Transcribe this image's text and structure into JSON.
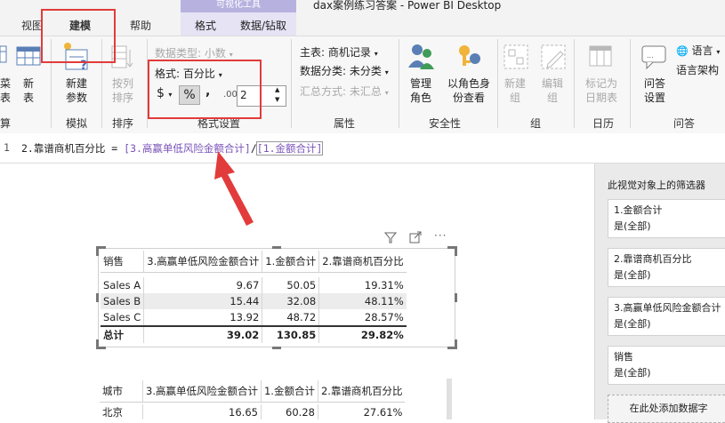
{
  "window": {
    "title": "dax案例练习答案 - Power BI Desktop",
    "context_group": "可视化工具"
  },
  "tabs": {
    "view": "视图",
    "modeling": "建模",
    "help": "帮助",
    "format": "格式",
    "data_drill": "数据/钻取"
  },
  "ribbon": {
    "left_partial_1": "菜",
    "left_partial_2": "表",
    "new_table_1": "新",
    "new_table_2": "表",
    "new_param_1": "新建",
    "new_param_2": "参数",
    "group_whatif": "模拟",
    "sort_by_col_1": "按列",
    "sort_by_col_2": "排序",
    "group_sort": "排序",
    "data_type": "数据类型: 小数",
    "format": "格式: 百分比",
    "currency_symbol": "$",
    "percent_symbol": "%",
    "comma_symbol": ",",
    "decimals_symbol": ".00",
    "decimal_places": "2",
    "group_formatting": "格式设置",
    "home_table": "主表: 商机记录",
    "data_category": "数据分类: 未分类",
    "summarize_by": "汇总方式: 未汇总",
    "group_properties": "属性",
    "manage_roles_1": "管理",
    "manage_roles_2": "角色",
    "view_as_1": "以角色身",
    "view_as_2": "份查看",
    "group_security": "安全性",
    "new_group_1": "新建",
    "new_group_2": "组",
    "edit_group_1": "编辑",
    "edit_group_2": "组",
    "group_groups": "组",
    "mark_date_1": "标记为",
    "mark_date_2": "日期表",
    "group_calendar": "日历",
    "qa_setup_1": "问答",
    "qa_setup_2": "设置",
    "language": "语言",
    "linguistic_schema": "语言架构",
    "group_qa": "问答",
    "left_group_partial": "算"
  },
  "formula": {
    "line_no": "1",
    "measure_name": "2.靠谱商机百分比",
    "equals": " = ",
    "ref1": "[3.高赢单低风险金额合计]",
    "divide": "/",
    "ref2": "[1.金额合计]"
  },
  "table1": {
    "headers": [
      "销售",
      "3.高赢单低风险金额合计",
      "1.金额合计",
      "2.靠谱商机百分比"
    ],
    "rows": [
      [
        "Sales A",
        "9.67",
        "50.05",
        "19.31%"
      ],
      [
        "Sales B",
        "15.44",
        "32.08",
        "48.11%"
      ],
      [
        "Sales C",
        "13.92",
        "48.72",
        "28.57%"
      ]
    ],
    "total": [
      "总计",
      "39.02",
      "130.85",
      "29.82%"
    ]
  },
  "table2": {
    "headers": [
      "城市",
      "3.高赢单低风险金额合计",
      "1.金额合计",
      "2.靠谱商机百分比"
    ],
    "rows": [
      [
        "北京",
        "16.65",
        "60.28",
        "27.61%"
      ]
    ]
  },
  "filters": {
    "pane_title": "此视觉对象上的筛选器",
    "cards": [
      {
        "field": "1.金额合计",
        "state": "是(全部)"
      },
      {
        "field": "2.靠谱商机百分比",
        "state": "是(全部)"
      },
      {
        "field": "3.高赢单低风险金额合计",
        "state": "是(全部)"
      },
      {
        "field": "销售",
        "state": "是(全部)"
      }
    ],
    "add_data": "在此处添加数据字"
  },
  "colors": {
    "accent_red": "#e23b3b",
    "context_purple": "#b7b1e0"
  }
}
